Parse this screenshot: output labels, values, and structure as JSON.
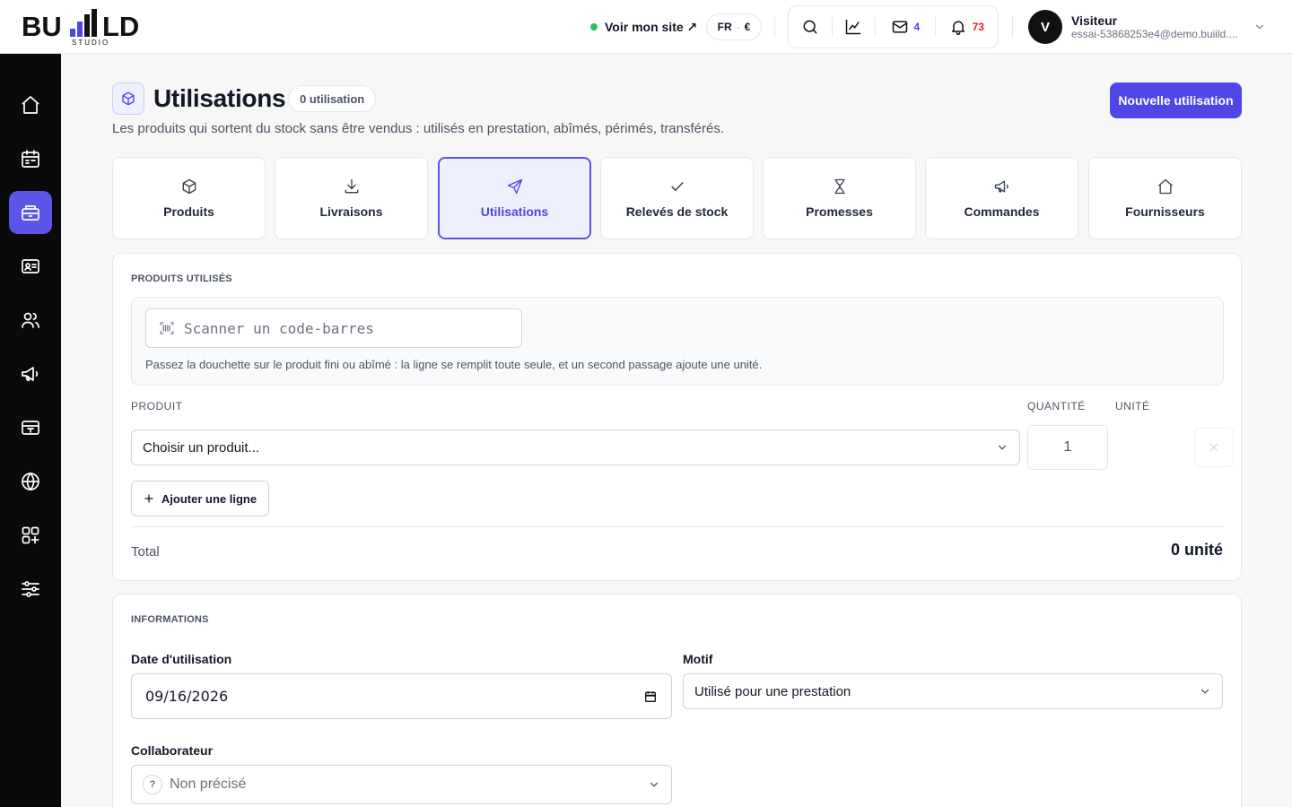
{
  "brand": {
    "logo_text": "BUILD",
    "logo_subtext": "STUDIO"
  },
  "topbar": {
    "site_link_label": "Voir mon site ↗",
    "lang": "FR",
    "currency": "€",
    "mail_count": "4",
    "notif_count": "73",
    "user_initial": "V",
    "user_name": "Visiteur",
    "user_email": "essai-53868253e4@demo.buiild...."
  },
  "sidebar": {
    "items": [
      {
        "name": "home",
        "icon": "home-icon"
      },
      {
        "name": "agenda",
        "icon": "calendar-icon"
      },
      {
        "name": "stock",
        "icon": "stock-icon",
        "active": true
      },
      {
        "name": "clients",
        "icon": "id-card-icon"
      },
      {
        "name": "team",
        "icon": "users-icon"
      },
      {
        "name": "marketing",
        "icon": "megaphone-icon"
      },
      {
        "name": "checkout",
        "icon": "cash-register-icon"
      },
      {
        "name": "website",
        "icon": "globe-icon"
      },
      {
        "name": "apps",
        "icon": "apps-icon"
      },
      {
        "name": "settings",
        "icon": "sliders-icon"
      }
    ]
  },
  "header": {
    "title": "Utilisations",
    "badge": "0 utilisation",
    "description": "Les produits qui sortent du stock sans être vendus : utilisés en prestation, abîmés, périmés, transférés.",
    "primary_button": "Nouvelle utilisation"
  },
  "tabs": [
    {
      "label": "Produits",
      "icon": "box-icon"
    },
    {
      "label": "Livraisons",
      "icon": "download-icon"
    },
    {
      "label": "Utilisations",
      "icon": "send-icon",
      "active": true
    },
    {
      "label": "Relevés de stock",
      "icon": "check-icon"
    },
    {
      "label": "Promesses",
      "icon": "hourglass-icon"
    },
    {
      "label": "Commandes",
      "icon": "megaphone-icon"
    },
    {
      "label": "Fournisseurs",
      "icon": "house-icon"
    }
  ],
  "products_card": {
    "section_label": "PRODUITS UTILISÉS",
    "scan_placeholder": "Scanner un code-barres",
    "scan_help": "Passez la douchette sur le produit fini ou abîmé : la ligne se remplit toute seule, et un second passage ajoute une unité.",
    "col_product": "PRODUIT",
    "col_quantity": "QUANTITÉ",
    "col_unit": "UNITÉ",
    "product_select": "Choisir un produit...",
    "quantity_value": "1",
    "add_line_label": "Ajouter une ligne",
    "total_label": "Total",
    "total_value": "0 unité"
  },
  "info_card": {
    "section_label": "INFORMATIONS",
    "date_label": "Date d'utilisation",
    "date_value": "09/16/2026",
    "reason_label": "Motif",
    "reason_value": "Utilisé pour une prestation",
    "collab_label": "Collaborateur",
    "collab_value": "Non précisé"
  },
  "colors": {
    "accent": "#4f46e5",
    "accent_soft": "#eef0fd",
    "sidebar_bg": "#0a0a0a",
    "online": "#22c55e",
    "notif": "#dc2626"
  }
}
